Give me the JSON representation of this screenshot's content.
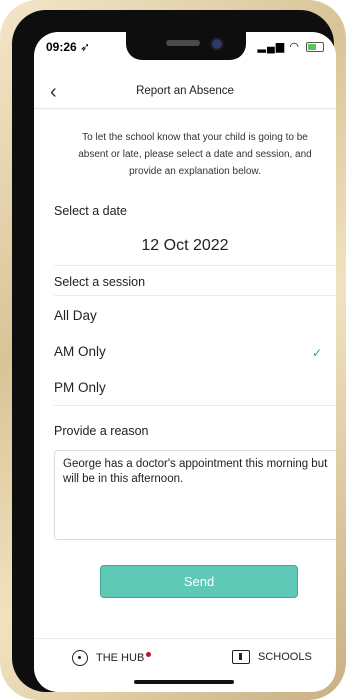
{
  "status": {
    "time": "09:26",
    "location_icon": "location-arrow-icon",
    "signal_text": "▐▐ ▾"
  },
  "nav": {
    "title": "Report an Absence",
    "back_glyph": "‹"
  },
  "intro": "To let the school know that your child is going to be absent or late, please select a date and session, and provide an explanation below.",
  "date": {
    "label": "Select a date",
    "value": "12 Oct 2022"
  },
  "session": {
    "label": "Select a session",
    "options": [
      {
        "label": "All Day",
        "selected": false
      },
      {
        "label": "AM Only",
        "selected": true
      },
      {
        "label": "PM Only",
        "selected": false
      }
    ],
    "check_glyph": "✓"
  },
  "reason": {
    "label": "Provide a reason",
    "value": "George has a doctor's appointment this morning but will be in this afternoon."
  },
  "send_label": "Send",
  "tabs": [
    {
      "label": "THE HUB",
      "icon": "hub-icon",
      "badge": true
    },
    {
      "label": "SCHOOLS",
      "icon": "school-icon",
      "badge": false
    }
  ],
  "colors": {
    "accent": "#5fc9b5",
    "check": "#27a596",
    "badge": "#b5142a",
    "frame": "#d8c497"
  }
}
